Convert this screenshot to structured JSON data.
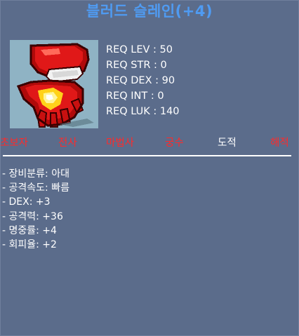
{
  "item": {
    "title": "블러드 슬레인(+4)",
    "icon": "red-glove-icon"
  },
  "requirements": [
    "REQ LEV : 50",
    "REQ STR : 0",
    "REQ DEX : 90",
    "REQ INT : 0",
    "REQ LUK : 140"
  ],
  "jobs": [
    {
      "label": "초보자",
      "available": false
    },
    {
      "label": "전사",
      "available": false
    },
    {
      "label": "마법사",
      "available": false
    },
    {
      "label": "궁수",
      "available": false
    },
    {
      "label": "도적",
      "available": true
    },
    {
      "label": "해적",
      "available": false
    }
  ],
  "stats": [
    "- 장비분류: 아대",
    "- 공격속도: 빠름",
    "- DEX: +3",
    "- 공격력: +36",
    "- 명중률: +4",
    "- 회피율: +2"
  ],
  "colors": {
    "background": "#5b6c8b",
    "title": "#4f9bf2",
    "unavailable_job": "#ff2a2a",
    "available_job": "#ffffff",
    "icon_bg": "#8fb3c4"
  }
}
